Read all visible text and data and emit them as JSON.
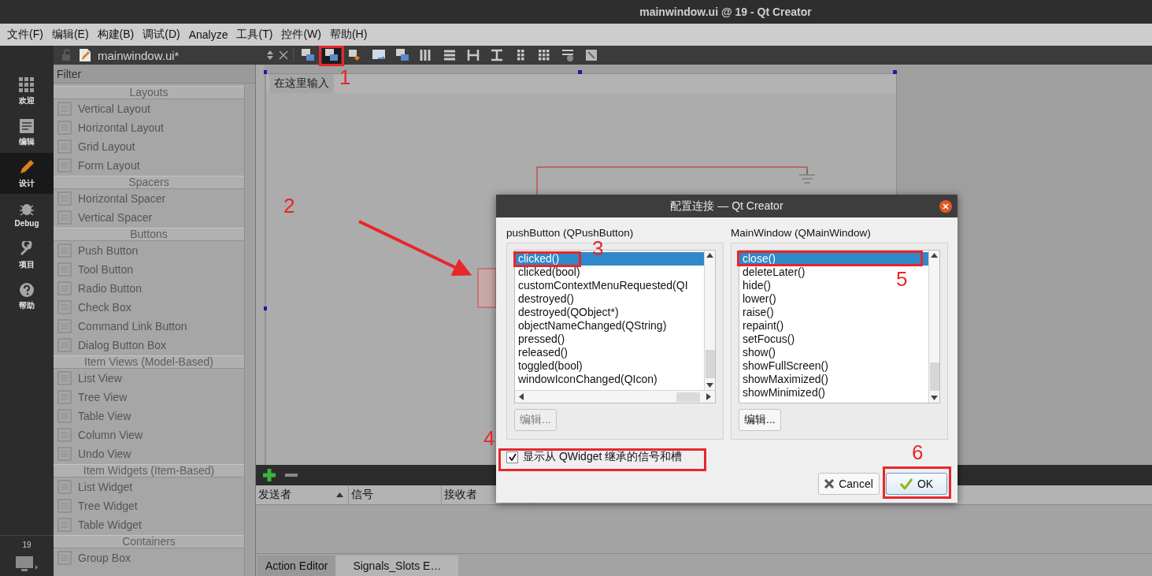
{
  "window": {
    "title": "mainwindow.ui @ 19 - Qt Creator"
  },
  "menu": [
    "文件(F)",
    "编辑(E)",
    "构建(B)",
    "调试(D)",
    "Analyze",
    "工具(T)",
    "控件(W)",
    "帮助(H)"
  ],
  "mode_bar": {
    "items": [
      {
        "label": "欢迎",
        "kind": "grid",
        "selected": false
      },
      {
        "label": "编辑",
        "kind": "document",
        "selected": false
      },
      {
        "label": "设计",
        "kind": "pencil",
        "selected": true
      },
      {
        "label": "Debug",
        "kind": "bug",
        "selected": false
      },
      {
        "label": "项目",
        "kind": "wrench",
        "selected": false
      },
      {
        "label": "帮助",
        "kind": "help",
        "selected": false
      }
    ],
    "session": "19"
  },
  "document": {
    "name": "mainwindow.ui*"
  },
  "widget_box": {
    "filter": {
      "placeholder": "Filter"
    },
    "categories": [
      {
        "name": "Layouts",
        "items": [
          "Vertical Layout",
          "Horizontal Layout",
          "Grid Layout",
          "Form Layout"
        ]
      },
      {
        "name": "Spacers",
        "items": [
          "Horizontal Spacer",
          "Vertical Spacer"
        ]
      },
      {
        "name": "Buttons",
        "items": [
          "Push Button",
          "Tool Button",
          "Radio Button",
          "Check Box",
          "Command Link Button",
          "Dialog Button Box"
        ]
      },
      {
        "name": "Item Views (Model-Based)",
        "items": [
          "List View",
          "Tree View",
          "Table View",
          "Column View",
          "Undo View"
        ]
      },
      {
        "name": "Item Widgets (Item-Based)",
        "items": [
          "List Widget",
          "Tree Widget",
          "Table Widget"
        ]
      },
      {
        "name": "Containers",
        "items": [
          "Group Box"
        ]
      }
    ]
  },
  "form": {
    "menu_placeholder": "在这里输入"
  },
  "connection_editor": {
    "columns": [
      "发送者",
      "信号",
      "接收者"
    ],
    "tabs": [
      {
        "label": "Action Editor",
        "selected": false
      },
      {
        "label": "Signals_Slots E…",
        "selected": true
      }
    ]
  },
  "dialog": {
    "title": "配置连接 — Qt Creator",
    "sender": {
      "label": "pushButton (QPushButton)",
      "items": [
        {
          "text": "clicked()",
          "selected": true
        },
        {
          "text": "clicked(bool)",
          "selected": false
        },
        {
          "text": "customContextMenuRequested(QI",
          "selected": false
        },
        {
          "text": "destroyed()",
          "selected": false
        },
        {
          "text": "destroyed(QObject*)",
          "selected": false
        },
        {
          "text": "objectNameChanged(QString)",
          "selected": false
        },
        {
          "text": "pressed()",
          "selected": false
        },
        {
          "text": "released()",
          "selected": false
        },
        {
          "text": "toggled(bool)",
          "selected": false
        },
        {
          "text": "windowIconChanged(QIcon)",
          "selected": false
        }
      ],
      "edit_button": {
        "label": "编辑...",
        "disabled": true
      }
    },
    "receiver": {
      "label": "MainWindow (QMainWindow)",
      "items": [
        {
          "text": "close()",
          "selected": true
        },
        {
          "text": "deleteLater()",
          "selected": false
        },
        {
          "text": "hide()",
          "selected": false
        },
        {
          "text": "lower()",
          "selected": false
        },
        {
          "text": "raise()",
          "selected": false
        },
        {
          "text": "repaint()",
          "selected": false
        },
        {
          "text": "setFocus()",
          "selected": false
        },
        {
          "text": "show()",
          "selected": false
        },
        {
          "text": "showFullScreen()",
          "selected": false
        },
        {
          "text": "showMaximized()",
          "selected": false
        },
        {
          "text": "showMinimized()",
          "selected": false
        }
      ],
      "edit_button": {
        "label": "编辑...",
        "disabled": false
      }
    },
    "inherited": {
      "label": "显示从 QWidget 继承的信号和槽",
      "checked": true
    },
    "buttons": [
      {
        "label": "Cancel",
        "kind": "cancel"
      },
      {
        "label": "OK",
        "kind": "ok"
      }
    ]
  },
  "annotations": [
    "1",
    "2",
    "3",
    "4",
    "5",
    "6"
  ]
}
